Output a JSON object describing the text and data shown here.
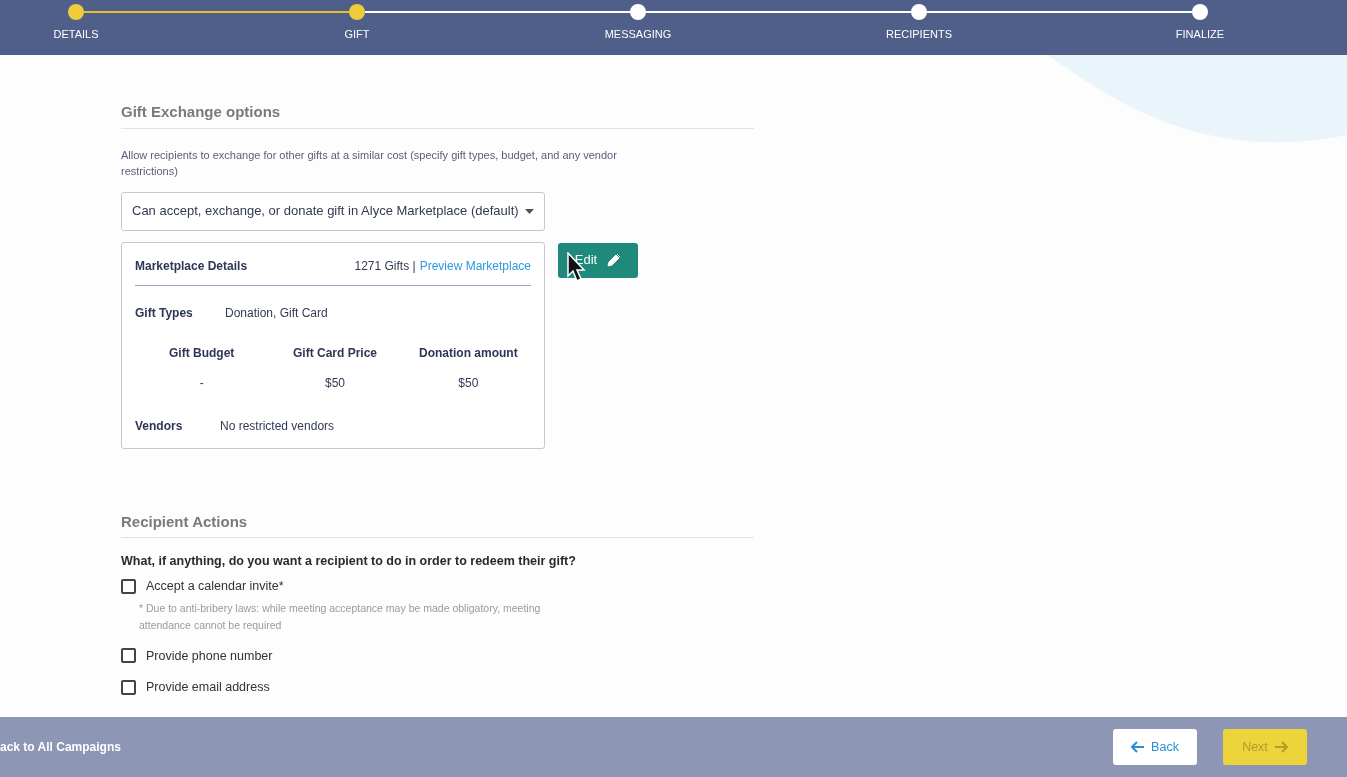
{
  "steps": [
    {
      "label": "DETAILS",
      "done": true
    },
    {
      "label": "GIFT",
      "done": true
    },
    {
      "label": "MESSAGING",
      "done": false
    },
    {
      "label": "RECIPIENTS",
      "done": false
    },
    {
      "label": "FINALIZE",
      "done": false
    }
  ],
  "exchange": {
    "title": "Gift Exchange options",
    "description": "Allow recipients to exchange for other gifts at a similar cost (specify gift types, budget, and any vendor restrictions)",
    "select_value": "Can accept, exchange, or donate gift in Alyce Marketplace (default)",
    "edit_button": "Edit"
  },
  "marketplace": {
    "title": "Marketplace Details",
    "gift_count": "1271 Gifts |",
    "preview_link": "Preview Marketplace",
    "gift_types_label": "Gift Types",
    "gift_types_value": "Donation, Gift Card",
    "prices": [
      {
        "label": "Gift Budget",
        "value": "-"
      },
      {
        "label": "Gift Card Price",
        "value": "$50"
      },
      {
        "label": "Donation amount",
        "value": "$50"
      }
    ],
    "vendors_label": "Vendors",
    "vendors_value": "No restricted vendors"
  },
  "actions": {
    "title": "Recipient Actions",
    "question": "What, if anything, do you want a recipient to do in order to redeem their gift?",
    "options": [
      {
        "label": "Accept a calendar invite*",
        "checked": false,
        "note": "* Due to anti-bribery laws: while meeting acceptance may be made obligatory, meeting attendance cannot be required"
      },
      {
        "label": "Provide phone number",
        "checked": false
      },
      {
        "label": "Provide email address",
        "checked": false
      }
    ]
  },
  "footer": {
    "back_link": "ack to All Campaigns",
    "back_button": "Back",
    "next_button": "Next",
    "next_disabled": true
  }
}
